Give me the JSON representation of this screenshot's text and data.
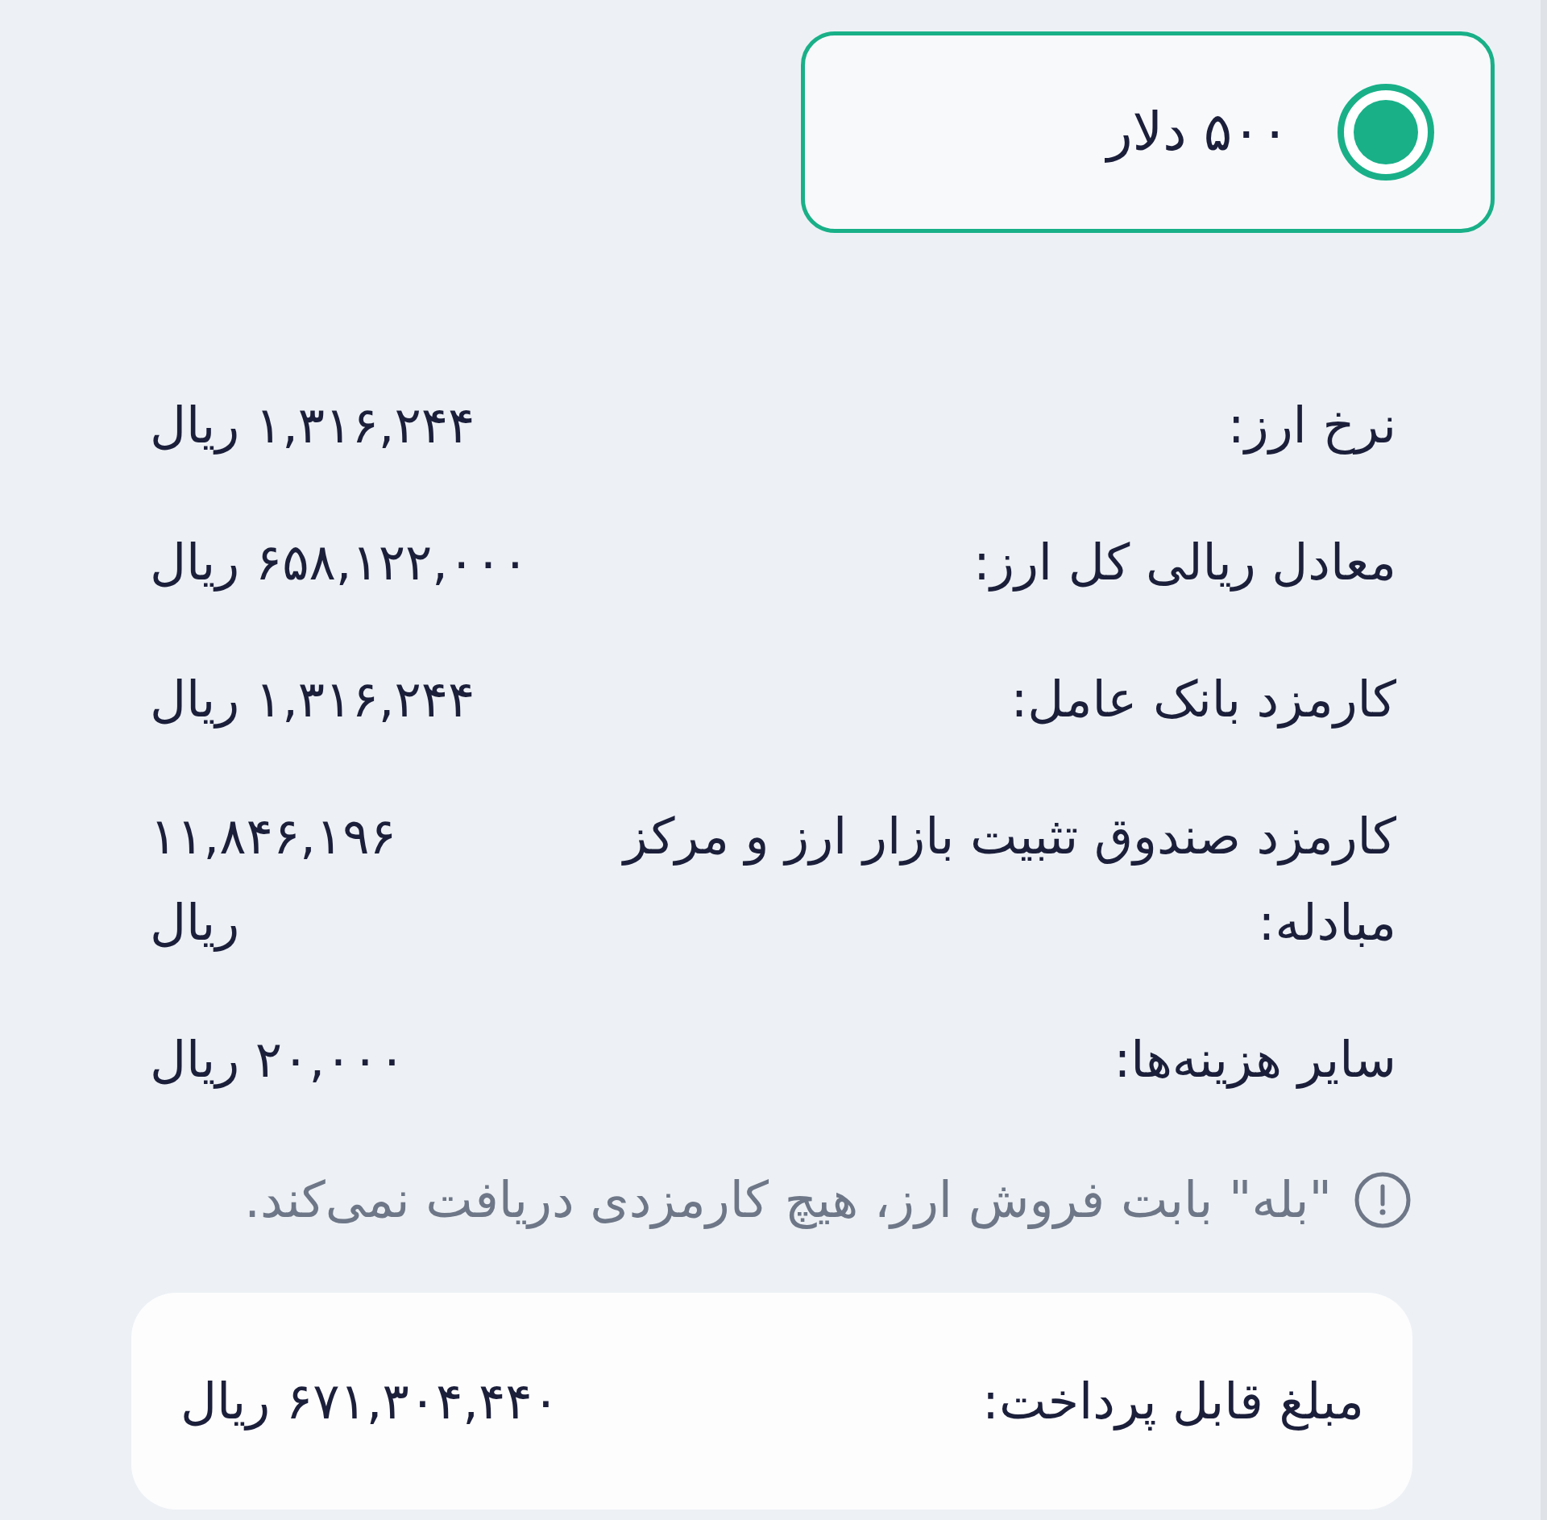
{
  "option": {
    "label": "۵۰۰ دلار",
    "selected": true
  },
  "rows": [
    {
      "label": "نرخ ارز:",
      "value": "۱,۳۱۶,۲۴۴ ریال"
    },
    {
      "label": "معادل ریالی کل ارز:",
      "value": "۶۵۸,۱۲۲,۰۰۰ ریال"
    },
    {
      "label": "کارمزد بانک عامل:",
      "value": "۱,۳۱۶,۲۴۴ ریال"
    },
    {
      "label": "کارمزد صندوق تثبیت بازار ارز و مرکز مبادله:",
      "value": "۱۱,۸۴۶,۱۹۶ ریال"
    },
    {
      "label": "سایر هزینه‌ها:",
      "value": "۲۰,۰۰۰ ریال"
    }
  ],
  "note": {
    "text": "\"بله\" بابت فروش ارز، هیچ کارمزدی دریافت نمی‌کند."
  },
  "total": {
    "label": "مبلغ قابل پرداخت:",
    "value": "۶۷۱,۳۰۴,۴۴۰ ریال"
  }
}
